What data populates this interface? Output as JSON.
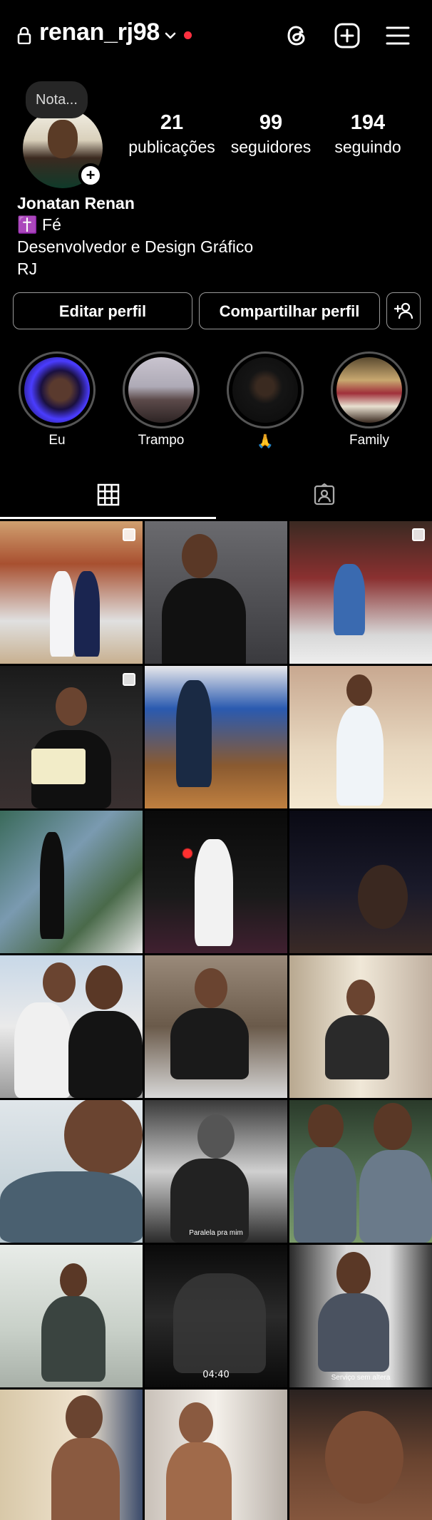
{
  "header": {
    "username": "renan_rj98",
    "icons": [
      "lock-icon",
      "chevron-down-icon",
      "threads-icon",
      "new-post-icon",
      "menu-icon"
    ]
  },
  "profile": {
    "note_placeholder": "Nota...",
    "stats": [
      {
        "value": "21",
        "label": "publicações"
      },
      {
        "value": "99",
        "label": "seguidores"
      },
      {
        "value": "194",
        "label": "seguindo"
      }
    ],
    "name": "Jonatan Renan",
    "bio_lines": [
      "✝️ Fé",
      "Desenvolvedor e Design Gráfico",
      "RJ"
    ]
  },
  "actions": {
    "edit_label": "Editar perfil",
    "share_label": "Compartilhar perfil"
  },
  "highlights": [
    {
      "label": "Eu"
    },
    {
      "label": "Trampo"
    },
    {
      "label": "🙏"
    },
    {
      "label": "Family"
    }
  ],
  "tabs": [
    "grid-tab",
    "tagged-tab"
  ],
  "posts": {
    "captions": {
      "p14": "Paralela pra mim",
      "p17": "Serviço sem altera"
    },
    "video_duration": "04:40"
  },
  "colors": {
    "background": "#000000",
    "accent_red": "#ff3040",
    "button_border": "#9a9a9a"
  }
}
